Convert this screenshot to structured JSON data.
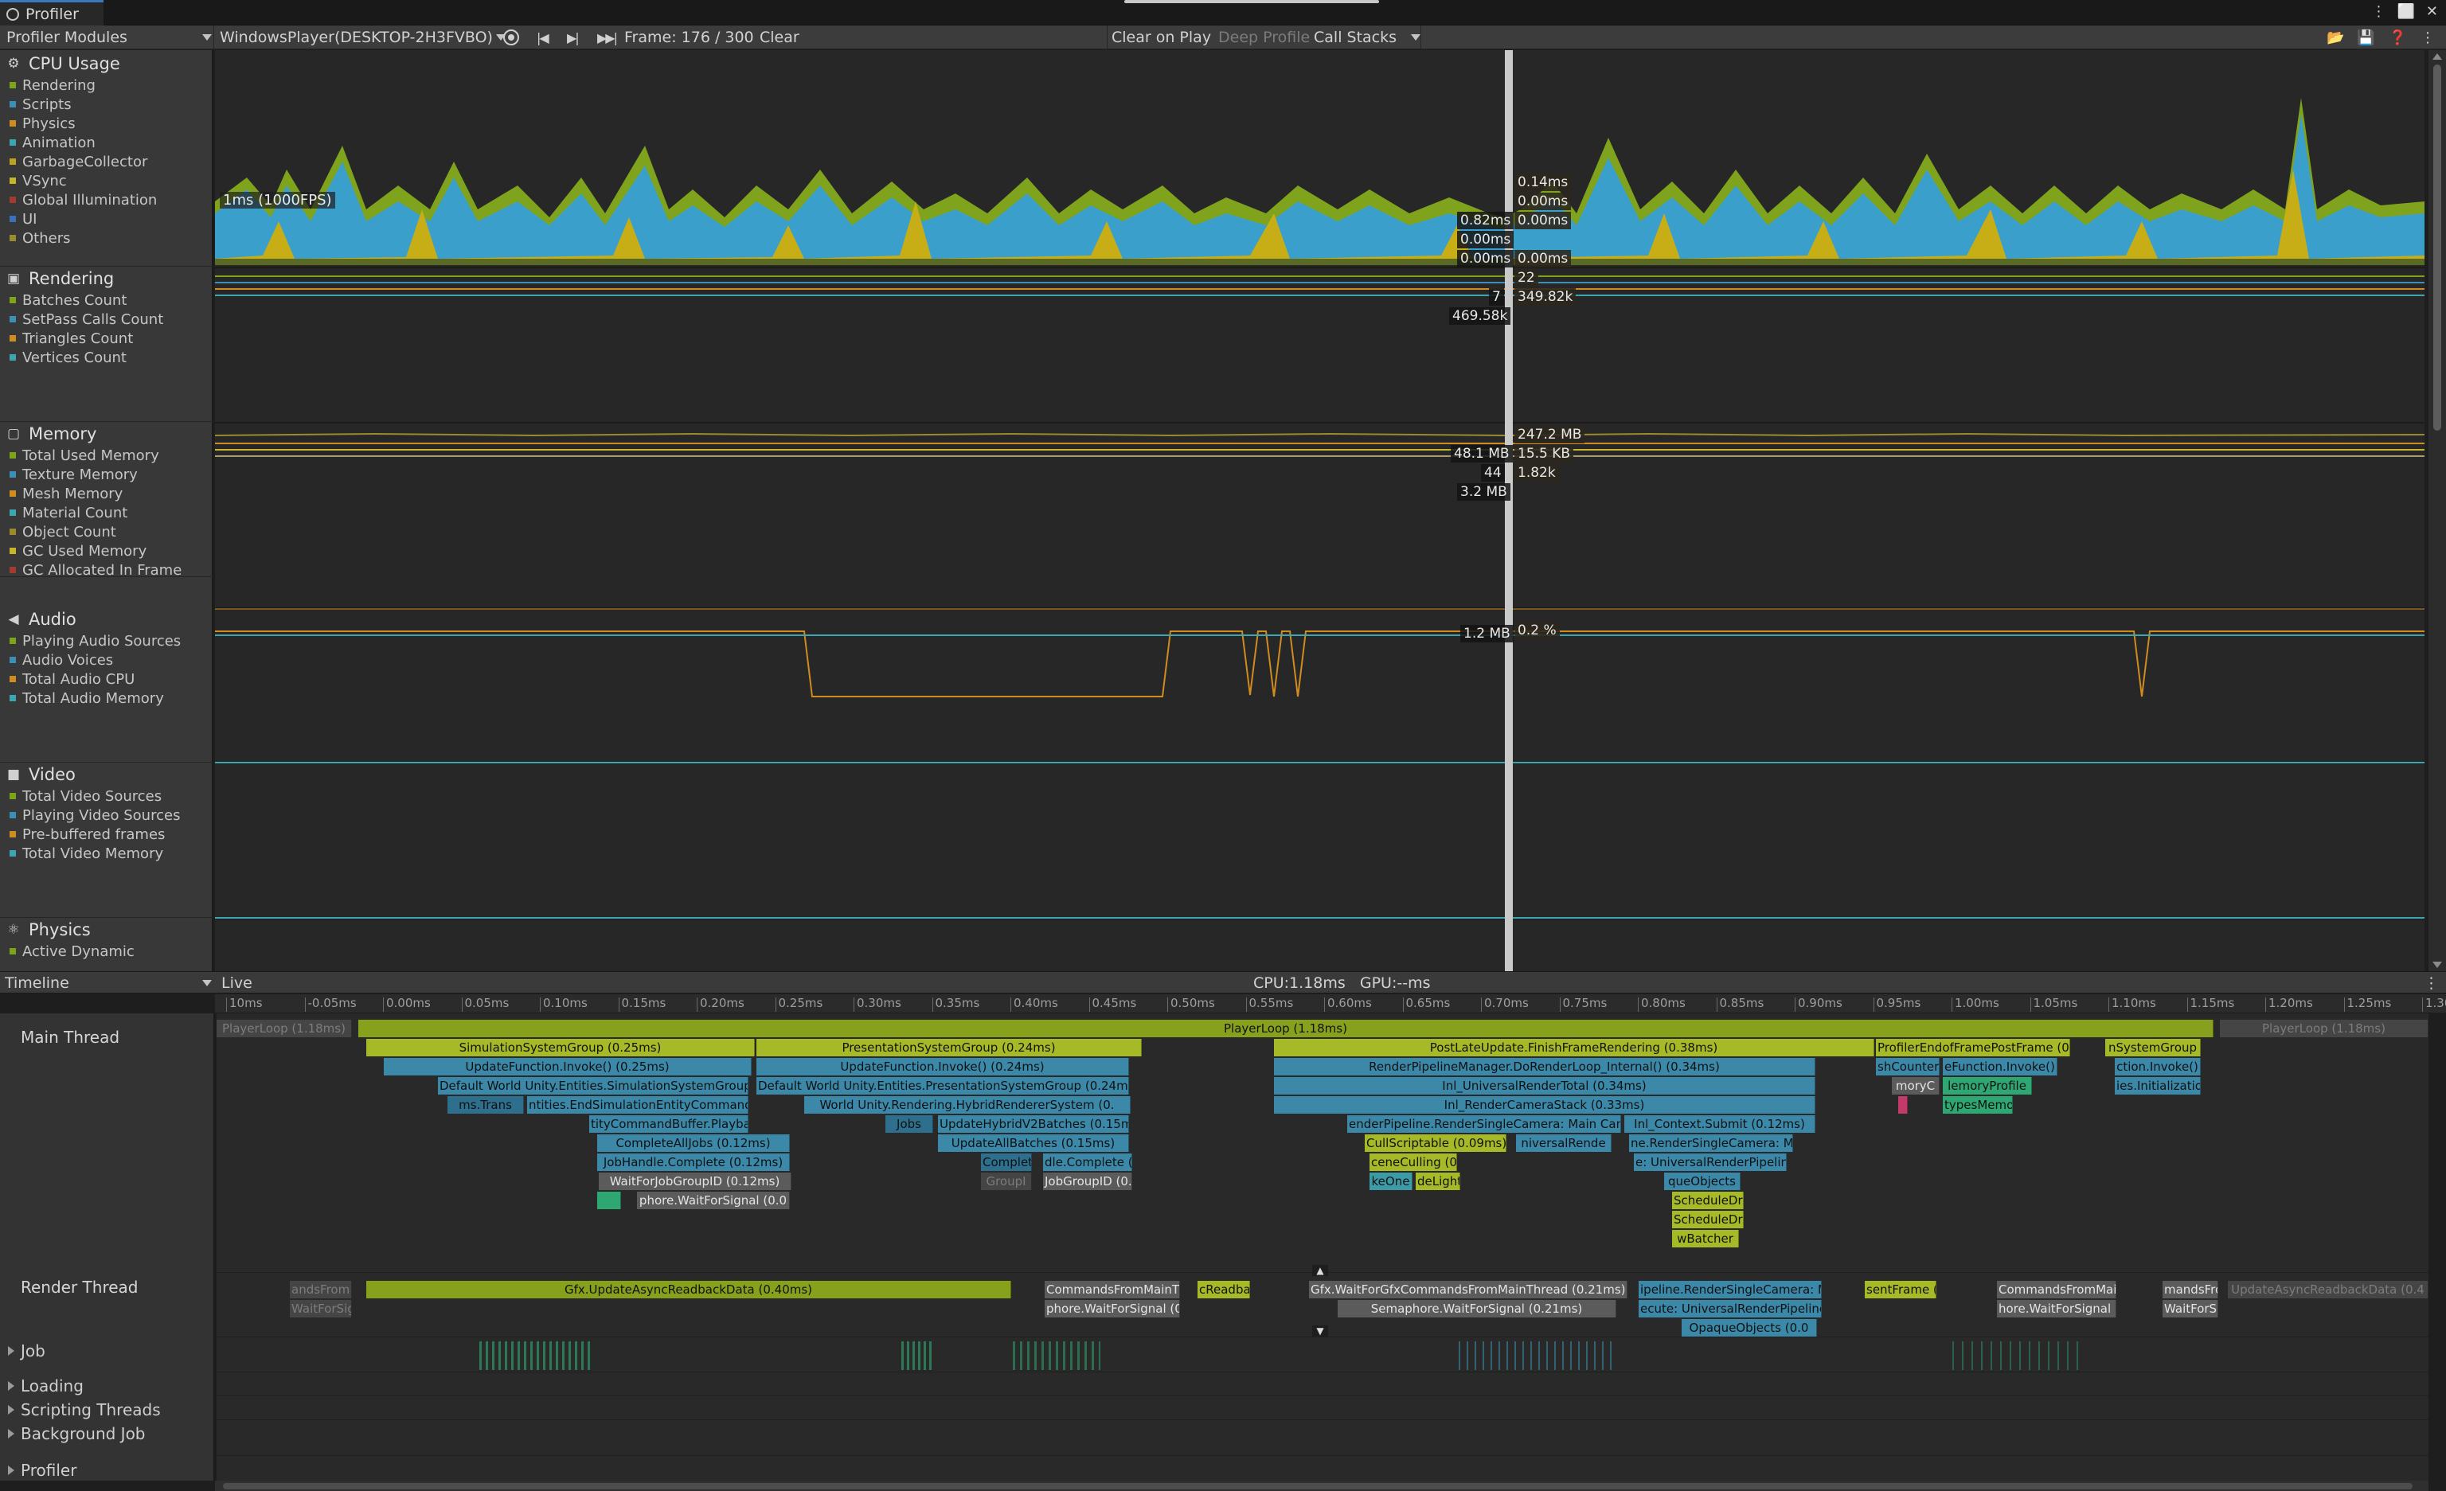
{
  "window": {
    "tab_title": "Profiler",
    "controls": [
      "⋮",
      "⬜",
      "✕"
    ]
  },
  "toolbar": {
    "modules_dropdown": "Profiler Modules",
    "target_dropdown": "WindowsPlayer(DESKTOP-2H3FVBO)",
    "frame_label": "Frame: 176 / 300",
    "clear": "Clear",
    "clear_on_play": "Clear on Play",
    "deep_profile": "Deep Profile",
    "call_stacks": "Call Stacks"
  },
  "modules": [
    {
      "title": "CPU Usage",
      "icon": "cpu-icon",
      "items": [
        {
          "label": "Rendering",
          "color": "#7fa31d"
        },
        {
          "label": "Scripts",
          "color": "#3b8fb9"
        },
        {
          "label": "Physics",
          "color": "#d08c1e"
        },
        {
          "label": "Animation",
          "color": "#3ca6b3"
        },
        {
          "label": "GarbageCollector",
          "color": "#bda31f"
        },
        {
          "label": "VSync",
          "color": "#c8b42a"
        },
        {
          "label": "Global Illumination",
          "color": "#a23c2e"
        },
        {
          "label": "UI",
          "color": "#3d6fc0"
        },
        {
          "label": "Others",
          "color": "#9b8b2f"
        }
      ]
    },
    {
      "title": "Rendering",
      "icon": "rendering-icon",
      "items": [
        {
          "label": "Batches Count",
          "color": "#7fa31d"
        },
        {
          "label": "SetPass Calls Count",
          "color": "#3b8fb9"
        },
        {
          "label": "Triangles Count",
          "color": "#d08c1e"
        },
        {
          "label": "Vertices Count",
          "color": "#3ca6b3"
        }
      ]
    },
    {
      "title": "Memory",
      "icon": "memory-icon",
      "items": [
        {
          "label": "Total Used Memory",
          "color": "#7fa31d"
        },
        {
          "label": "Texture Memory",
          "color": "#3b8fb9"
        },
        {
          "label": "Mesh Memory",
          "color": "#d08c1e"
        },
        {
          "label": "Material Count",
          "color": "#3ca6b3"
        },
        {
          "label": "Object Count",
          "color": "#9b8b2f"
        },
        {
          "label": "GC Used Memory",
          "color": "#c8b42a"
        },
        {
          "label": "GC Allocated In Frame",
          "color": "#a23c2e"
        }
      ]
    },
    {
      "title": "Audio",
      "icon": "audio-icon",
      "items": [
        {
          "label": "Playing Audio Sources",
          "color": "#7fa31d"
        },
        {
          "label": "Audio Voices",
          "color": "#3b8fb9"
        },
        {
          "label": "Total Audio CPU",
          "color": "#d08c1e"
        },
        {
          "label": "Total Audio Memory",
          "color": "#3ca6b3"
        }
      ]
    },
    {
      "title": "Video",
      "icon": "video-icon",
      "items": [
        {
          "label": "Total Video Sources",
          "color": "#7fa31d"
        },
        {
          "label": "Playing Video Sources",
          "color": "#3b8fb9"
        },
        {
          "label": "Pre-buffered frames",
          "color": "#d08c1e"
        },
        {
          "label": "Total Video Memory",
          "color": "#3ca6b3"
        }
      ]
    },
    {
      "title": "Physics",
      "icon": "physics-icon",
      "items": [
        {
          "label": "Active Dynamic",
          "color": "#7fa31d"
        }
      ]
    }
  ],
  "charts": {
    "fps_label": "1ms (1000FPS)",
    "cpu_left": [
      "0.82ms",
      "0.00ms",
      "0.00ms"
    ],
    "cpu_right": [
      "0.14ms",
      "0.00ms",
      "0.00ms",
      "0.00ms"
    ],
    "rendering_left": [
      "7",
      "469.58k"
    ],
    "rendering_right": [
      "22",
      "349.82k"
    ],
    "memory_left": [
      "48.1 MB",
      "44",
      "3.2 MB"
    ],
    "memory_right": [
      "247.2 MB",
      "15.5 KB",
      "1.82k"
    ],
    "audio_left": "1.2 MB",
    "audio_right": "0.2 %"
  },
  "details": {
    "view_dropdown": "Timeline",
    "live": "Live",
    "cpu_gpu": "CPU:1.18ms   GPU:--ms"
  },
  "ruler_ticks": [
    "10ms",
    "-0.05ms",
    "0.00ms",
    "0.05ms",
    "0.10ms",
    "0.15ms",
    "0.20ms",
    "0.25ms",
    "0.30ms",
    "0.35ms",
    "0.40ms",
    "0.45ms",
    "0.50ms",
    "0.55ms",
    "0.60ms",
    "0.65ms",
    "0.70ms",
    "0.75ms",
    "0.80ms",
    "0.85ms",
    "0.90ms",
    "0.95ms",
    "1.00ms",
    "1.05ms",
    "1.10ms",
    "1.15ms",
    "1.20ms",
    "1.25ms",
    "1.30ms"
  ],
  "threads": {
    "main": "Main Thread",
    "render": "Render Thread",
    "job": "Job",
    "loading": "Loading",
    "scripting": "Scripting Threads",
    "background": "Background Job",
    "profiler": "Profiler"
  },
  "bars": {
    "playerloop": "PlayerLoop (1.18ms)",
    "playerloop_prev": "PlayerLoop (1.18ms)",
    "playerloop_next": "PlayerLoop (1.18ms)",
    "sim_group": "SimulationSystemGroup (0.25ms)",
    "pres_group": "PresentationSystemGroup (0.24ms)",
    "post_late": "PostLateUpdate.FinishFrameRendering (0.38ms)",
    "profiler_end": "ProfilerEndofFramePostFrame (0.09m",
    "n_system_group": "nSystemGroup",
    "upd_func_1": "UpdateFunction.Invoke() (0.25ms)",
    "upd_func_2": "UpdateFunction.Invoke() (0.24ms)",
    "rp_manager": "RenderPipelineManager.DoRenderLoop_Internal() (0.34ms)",
    "sh_counter": "shCounter",
    "e_function": "eFunction.Invoke() (0.",
    "ction_invoke": "ction.Invoke()",
    "default_sim": "Default World Unity.Entities.SimulationSystemGroup (0.25ms)",
    "default_pres": "Default World Unity.Entities.PresentationSystemGroup (0.24ms)",
    "inl_total": "Inl_UniversalRenderTotal (0.34ms)",
    "mory": "moryC",
    "memory_profile": "lemoryProfile",
    "ies_init": "ies.Initializatio",
    "ms_trans": "ms.Trans",
    "entities_end": "ntities.EndSimulationEntityCommandBu",
    "hybrid_renderer": "World Unity.Rendering.HybridRendererSystem (0.",
    "inl_stack": "Inl_RenderCameraStack (0.33ms)",
    "types_mem": "typesMemo",
    "cmd_playback": "tityCommandBuffer.Playback (0.13m",
    "jobs": "Jobs",
    "update_hybrid": "UpdateHybridV2Batches (0.15ms)",
    "render_single_cam": "enderPipeline.RenderSingleCamera: Main Cam",
    "inl_context": "Inl_Context.Submit (0.12ms)",
    "complete_all": "CompleteAllJobs (0.12ms)",
    "update_all_batches": "UpdateAllBatches (0.15ms)",
    "cull_scriptable": "CullScriptable (0.09ms)",
    "universal_render": "niversalRende",
    "render_single_cam2": "ne.RenderSingleCamera: M",
    "jobhandle": "JobHandle.Complete (0.12ms)",
    "complete_short": "Complet",
    "dle_complete": "dle.Complete (0.",
    "scene_culling": "ceneCulling (0.07m",
    "universal_pipeline": "e: UniversalRenderPipeline",
    "wait_jobgroup": "WaitForJobGroupID (0.12ms)",
    "groupi": "GroupI",
    "jobgroupid": "JobGroupID (0.",
    "eone": "keOne",
    "lelights": "deLights",
    "opaque_objects": "queObjects",
    "semaphore": "phore.WaitForSignal (0.0",
    "sched_dr": "ScheduleDr",
    "sched_dr2": "ScheduleDr",
    "wbatcher": "wBatcher",
    "gfx_readback": "Gfx.UpdateAsyncReadbackData (0.40ms)",
    "commands_main": "CommandsFromMainTh",
    "readback_short": "cReadba",
    "gfx_wait": "Gfx.WaitForGfxCommandsFromMainThread (0.21ms)",
    "pipeline_render": "ipeline.RenderSingleCamera: Main",
    "present_frame": "sentFrame (",
    "commands_main2": "CommandsFromMain",
    "ands_from": "andsFrom",
    "update_async": "UpdateAsyncReadbackData (0.4",
    "hands_from": "mandsFrom",
    "wait_for_sign": "WaitForSign",
    "phore_wait": "phore.WaitForSignal (0.0",
    "semaphore_wait": "Semaphore.WaitForSignal (0.21ms)",
    "execute_universal": "ecute: UniversalRenderPipelineAs",
    "wait_for_signal_r": "hore.WaitForSignal (0",
    "wait_for_s2": "WaitForSi",
    "opaque_objects2": "OpaqueObjects (0.0"
  }
}
